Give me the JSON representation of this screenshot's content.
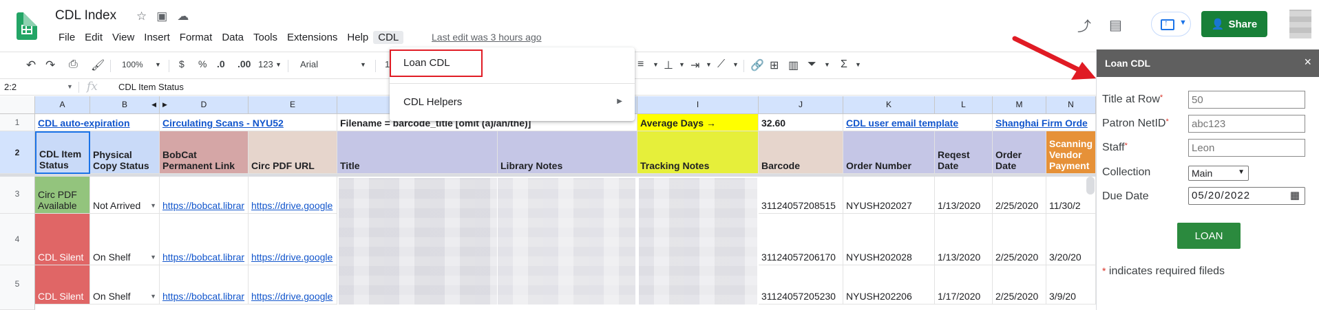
{
  "app": {
    "doc_title": "CDL Index",
    "menu": [
      "File",
      "Edit",
      "View",
      "Insert",
      "Format",
      "Data",
      "Tools",
      "Extensions",
      "Help",
      "CDL"
    ],
    "last_edit": "Last edit was 3 hours ago",
    "share_label": "Share"
  },
  "toolbar": {
    "zoom": "100%",
    "currency": "$",
    "percent": "%",
    "dec_less": ".0",
    "dec_more": ".00",
    "format_more": "123",
    "font": "Arial",
    "font_size_partial": "1"
  },
  "formula_bar": {
    "cell_ref": "2:2",
    "fx": "fx",
    "content": "CDL Item Status"
  },
  "cdl_menu": {
    "items": [
      "Loan CDL",
      "CDL Helpers"
    ]
  },
  "grid": {
    "columns": [
      "A",
      "B",
      "D",
      "E",
      "I",
      "J",
      "K",
      "L",
      "M",
      "N"
    ],
    "row_numbers": [
      "1",
      "2",
      "3",
      "4",
      "5"
    ],
    "row1": {
      "a": "CDL auto-expiration",
      "d": "Circulating Scans - NYU52",
      "title": "Filename = barcode_title [omit (a)/an/the)]",
      "avg_label": "Average Days →",
      "avg_value": "32.60",
      "k": "CDL user email template",
      "m": "Shanghai Firm Orde"
    },
    "headers": {
      "a": "CDL Item Status",
      "b": "Physical Copy Status",
      "d": "BobCat Permanent Link",
      "e": "Circ PDF URL",
      "title": "Title",
      "library_notes": "Library Notes",
      "tracking_notes": "Tracking Notes",
      "barcode": "Barcode",
      "order_number": "Order Number",
      "reqest_date": "Reqest Date",
      "order_date": "Order Date",
      "n": "Scanning Vendor Payment"
    },
    "rows": [
      {
        "status": "Circ PDF Available",
        "physical": "Not Arrived",
        "bobcat": "https://bobcat.librar",
        "drive": "https://drive.google",
        "barcode": "31124057208515",
        "order": "NYUSH202027",
        "req": "1/13/2020",
        "ord": "2/25/2020",
        "pay": "11/30/2"
      },
      {
        "status": "CDL Silent",
        "physical": "On Shelf",
        "bobcat": "https://bobcat.librar",
        "drive": "https://drive.google",
        "barcode": "31124057206170",
        "order": "NYUSH202028",
        "req": "1/13/2020",
        "ord": "2/25/2020",
        "pay": "3/20/20"
      },
      {
        "status": "CDL Silent",
        "physical": "On Shelf",
        "bobcat": "https://bobcat.librar",
        "drive": "https://drive.google",
        "barcode": "31124057205230",
        "order": "NYUSH202206",
        "req": "1/17/2020",
        "ord": "2/25/2020",
        "pay": "3/9/20"
      }
    ]
  },
  "sidebar": {
    "title": "Loan CDL",
    "close": "×",
    "fields": {
      "title_at_row": {
        "label": "Title at Row",
        "placeholder": "50"
      },
      "patron_netid": {
        "label": "Patron NetID",
        "placeholder": "abc123"
      },
      "staff": {
        "label": "Staff",
        "placeholder": "Leon"
      },
      "collection": {
        "label": "Collection",
        "value": "Main"
      },
      "due_date": {
        "label": "Due Date",
        "value": "05/20/2022"
      }
    },
    "required_mark": "*",
    "loan_button": "LOAN",
    "note": "indicates required fileds"
  },
  "colors": {
    "green_status": "#93c47d",
    "red_status": "#e06666",
    "header_blue": "#c9daf8",
    "header_lavender": "#c5c6e6",
    "header_rose": "#d5a6a6",
    "header_tan": "#e6d5cc",
    "yellow": "#ffff00",
    "lime": "#e6ef3a",
    "orange": "#e69138",
    "share_green": "#188038",
    "arrow_red": "#e01b24"
  }
}
